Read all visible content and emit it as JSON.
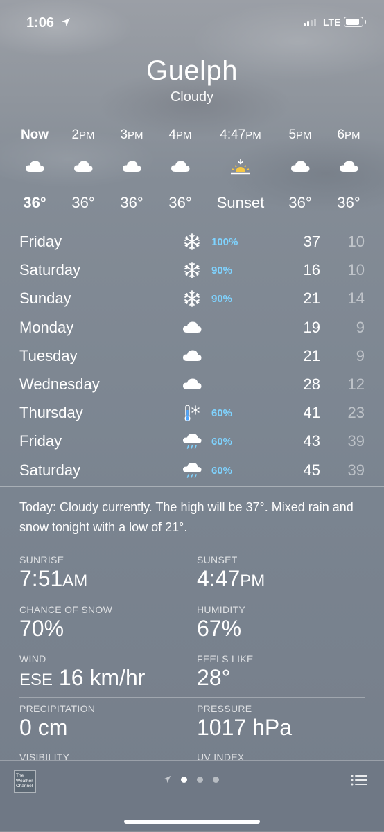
{
  "status": {
    "time": "1:06",
    "network": "LTE"
  },
  "location": {
    "city": "Guelph",
    "condition": "Cloudy"
  },
  "hourly": [
    {
      "time": "Now",
      "suffix": "",
      "icon": "cloud-icon",
      "value": "36°"
    },
    {
      "time": "2",
      "suffix": "PM",
      "icon": "cloud-icon",
      "value": "36°"
    },
    {
      "time": "3",
      "suffix": "PM",
      "icon": "cloud-icon",
      "value": "36°"
    },
    {
      "time": "4",
      "suffix": "PM",
      "icon": "cloud-icon",
      "value": "36°"
    },
    {
      "time": "4:47",
      "suffix": "PM",
      "icon": "sunset-icon",
      "value": "Sunset"
    },
    {
      "time": "5",
      "suffix": "PM",
      "icon": "cloud-icon",
      "value": "36°"
    },
    {
      "time": "6",
      "suffix": "PM",
      "icon": "cloud-icon",
      "value": "36°"
    }
  ],
  "daily": [
    {
      "day": "Friday",
      "icon": "snowflake-icon",
      "chance": "100%",
      "high": "37",
      "low": "10"
    },
    {
      "day": "Saturday",
      "icon": "snowflake-icon",
      "chance": "90%",
      "high": "16",
      "low": "10"
    },
    {
      "day": "Sunday",
      "icon": "snowflake-icon",
      "chance": "90%",
      "high": "21",
      "low": "14"
    },
    {
      "day": "Monday",
      "icon": "cloud-icon",
      "chance": "",
      "high": "19",
      "low": "9"
    },
    {
      "day": "Tuesday",
      "icon": "cloud-icon",
      "chance": "",
      "high": "21",
      "low": "9"
    },
    {
      "day": "Wednesday",
      "icon": "cloud-icon",
      "chance": "",
      "high": "28",
      "low": "12"
    },
    {
      "day": "Thursday",
      "icon": "thermometer-snow-icon",
      "chance": "60%",
      "high": "41",
      "low": "23"
    },
    {
      "day": "Friday",
      "icon": "rain-cloud-icon",
      "chance": "60%",
      "high": "43",
      "low": "39"
    },
    {
      "day": "Saturday",
      "icon": "rain-cloud-icon",
      "chance": "60%",
      "high": "45",
      "low": "39"
    }
  ],
  "summary": "Today: Cloudy currently. The high will be 37°. Mixed rain and snow tonight with a low of 21°.",
  "details": {
    "sunrise": {
      "label": "SUNRISE",
      "value": "7:51",
      "suffix": "AM"
    },
    "sunset": {
      "label": "SUNSET",
      "value": "4:47",
      "suffix": "PM"
    },
    "snow": {
      "label": "CHANCE OF SNOW",
      "value": "70%"
    },
    "humidity": {
      "label": "HUMIDITY",
      "value": "67%"
    },
    "wind": {
      "label": "WIND",
      "direction": "ESE",
      "value": "16 km/hr"
    },
    "feels_like": {
      "label": "FEELS LIKE",
      "value": "28°"
    },
    "precipitation": {
      "label": "PRECIPITATION",
      "value": "0 cm"
    },
    "pressure": {
      "label": "PRESSURE",
      "value": "1017 hPa"
    },
    "visibility": {
      "label": "VISIBILITY"
    },
    "uv": {
      "label": "UV INDEX"
    }
  },
  "footer": {
    "logo_text": [
      "The",
      "Weather",
      "Channel"
    ],
    "pages": 3,
    "active_page": 1
  },
  "colors": {
    "precip_accent": "#7fd3ff",
    "sunset_sun": "#f6c744"
  }
}
